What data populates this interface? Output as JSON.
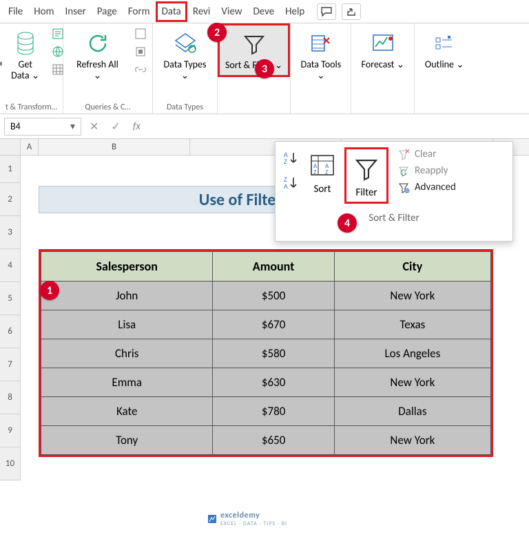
{
  "tabs": {
    "file": "File",
    "home": "Hom",
    "insert": "Inser",
    "page": "Page",
    "form": "Form",
    "data": "Data",
    "review": "Revi",
    "view": "View",
    "dev": "Deve",
    "help": "Help"
  },
  "ribbon": {
    "getdata": {
      "label": "Get Data ⌄",
      "caption": "t & Transform…"
    },
    "refresh": {
      "label": "Refresh All ⌄",
      "caption": "Queries & C…"
    },
    "datatypes": {
      "label": "Data Types ⌄",
      "caption": "Data Types"
    },
    "sortfilter": {
      "label": "Sort & Filter ⌄"
    },
    "datatools": {
      "label": "Data Tools ⌄"
    },
    "forecast": {
      "label": "Forecast ⌄"
    },
    "outline": {
      "label": "Outline ⌄"
    }
  },
  "submenu": {
    "sort": "Sort",
    "filter": "Filter",
    "clear": "Clear",
    "reapply": "Reapply",
    "advanced": "Advanced",
    "caption": "Sort & Filter"
  },
  "namebox": "B4",
  "fx": "fx",
  "cols": {
    "A": "A",
    "B": "B"
  },
  "rowlabels": [
    "1",
    "2",
    "3",
    "4",
    "5",
    "6",
    "7",
    "8",
    "9",
    "10"
  ],
  "sheet_title": "Use of Filter Option",
  "table": {
    "headers": [
      "Salesperson",
      "Amount",
      "City"
    ],
    "rows": [
      [
        "John",
        "$500",
        "New York"
      ],
      [
        "Lisa",
        "$670",
        "Texas"
      ],
      [
        "Chris",
        "$580",
        "Los Angeles"
      ],
      [
        "Emma",
        "$630",
        "New York"
      ],
      [
        "Kate",
        "$780",
        "Dallas"
      ],
      [
        "Tony",
        "$650",
        "New York"
      ]
    ]
  },
  "badges": {
    "b1": "1",
    "b2": "2",
    "b3": "3",
    "b4": "4"
  },
  "watermark": {
    "main": "exceldemy",
    "sub": "EXCEL · DATA · TIPS · BI"
  }
}
